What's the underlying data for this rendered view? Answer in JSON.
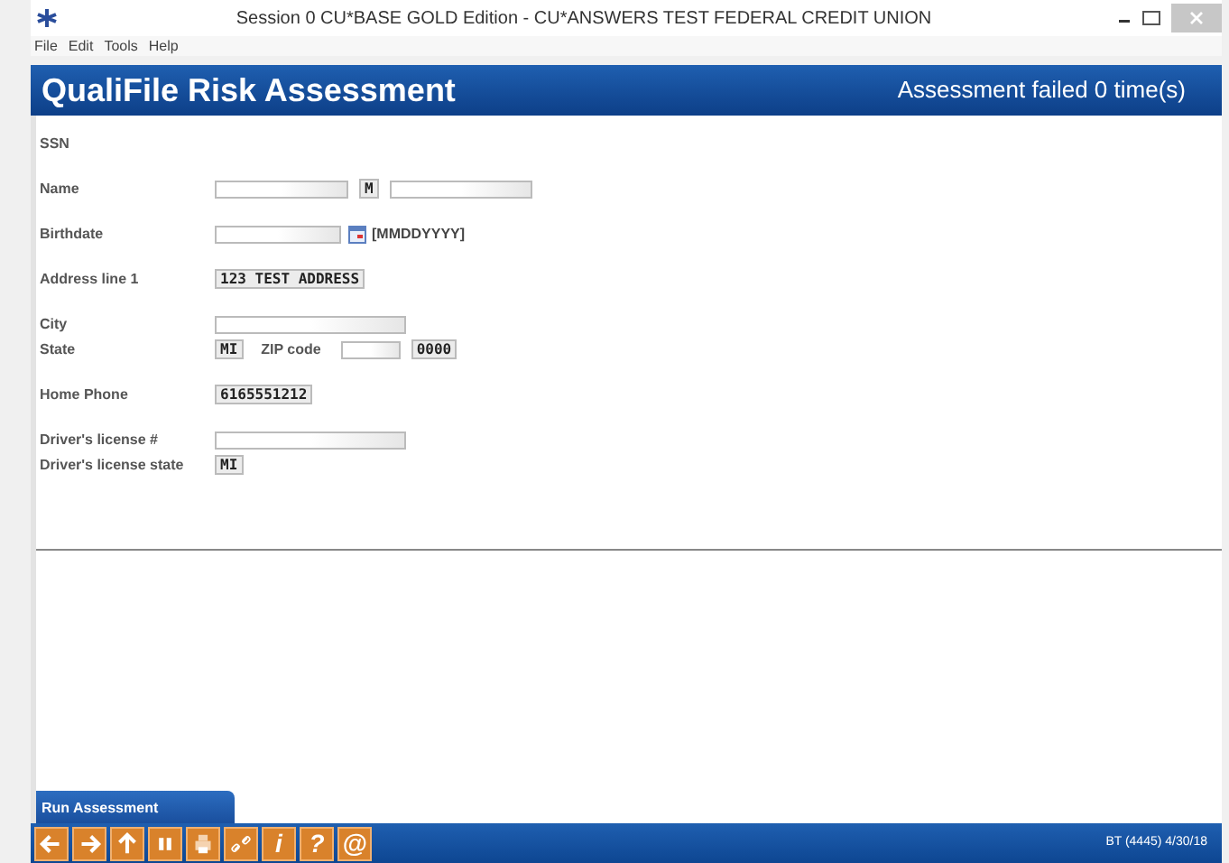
{
  "window": {
    "title": "Session 0 CU*BASE GOLD Edition - CU*ANSWERS TEST FEDERAL CREDIT UNION"
  },
  "menu": [
    "File",
    "Edit",
    "Tools",
    "Help"
  ],
  "header": {
    "title": "QualiFile Risk Assessment",
    "status": "Assessment failed 0 time(s)"
  },
  "form_groups": [
    [
      {
        "label": "SSN"
      }
    ],
    [
      {
        "label": "Name",
        "controls": [
          {
            "kind": "field"
          },
          {
            "kind": "value",
            "text": "M"
          },
          {
            "kind": "field"
          }
        ]
      }
    ],
    [
      {
        "label": "Birthdate",
        "controls": [
          {
            "kind": "field"
          },
          {
            "kind": "picker"
          },
          {
            "kind": "hint",
            "text": "[MMDDYYYY]"
          }
        ]
      }
    ],
    [
      {
        "label": "Address line 1",
        "controls": [
          {
            "kind": "value",
            "text": "123 TEST ADDRESS"
          }
        ]
      }
    ],
    [
      {
        "label": "City",
        "controls": [
          {
            "kind": "field"
          }
        ]
      },
      {
        "label": "State",
        "controls": [
          {
            "kind": "value",
            "text": "MI"
          },
          {
            "kind": "label",
            "text": "ZIP code"
          },
          {
            "kind": "field"
          },
          {
            "kind": "value",
            "text": "0000"
          }
        ]
      }
    ],
    [
      {
        "label": "Home Phone",
        "controls": [
          {
            "kind": "value",
            "text": "6165551212"
          }
        ]
      }
    ],
    [
      {
        "label": "Driver's license #",
        "controls": [
          {
            "kind": "field"
          }
        ]
      },
      {
        "label": "Driver's license state",
        "controls": [
          {
            "kind": "value",
            "text": "MI"
          }
        ]
      }
    ]
  ],
  "action_tab": "Run Assessment",
  "toolbar": {
    "text_buttons": [
      "i",
      "?",
      "@"
    ],
    "status": "BT (4445) 4/30/18"
  }
}
